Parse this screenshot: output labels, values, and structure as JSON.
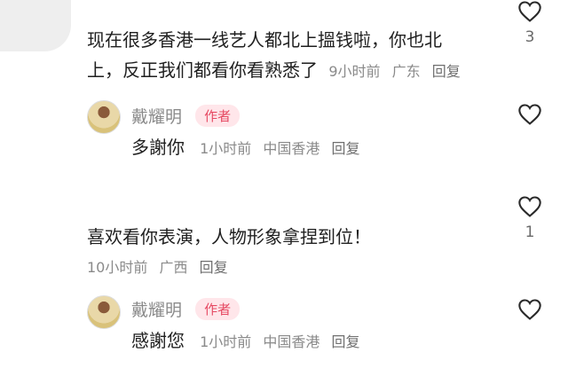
{
  "comments": [
    {
      "text_line1": "现在很多香港一线艺人都北上搵钱啦，你也北",
      "text_line2": "上，反正我们都看你看熟悉了",
      "time": "9小时前",
      "location": "广东",
      "reply_label": "回复",
      "like_count": "3",
      "reply": {
        "author": "戴耀明",
        "badge": "作者",
        "text": "多謝你",
        "time": "1小时前",
        "location": "中国香港",
        "reply_label": "回复"
      }
    },
    {
      "text_line1": "喜欢看你表演，人物形象拿捏到位！",
      "time": "10小时前",
      "location": "广西",
      "reply_label": "回复",
      "like_count": "1",
      "reply": {
        "author": "戴耀明",
        "badge": "作者",
        "text": "感謝您",
        "time": "1小时前",
        "location": "中国香港",
        "reply_label": "回复"
      }
    }
  ]
}
